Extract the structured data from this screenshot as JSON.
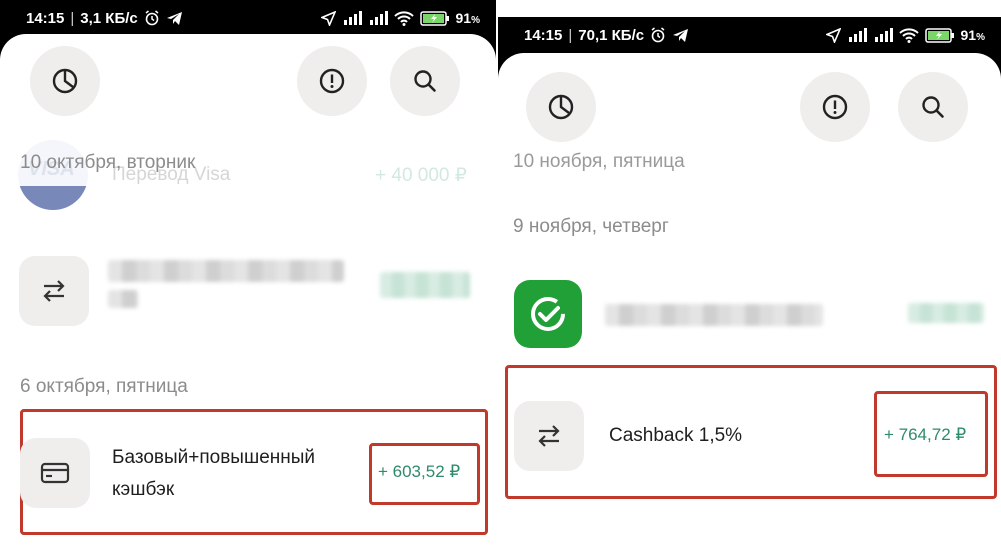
{
  "left": {
    "status": {
      "time": "14:15",
      "speed": "3,1 КБ/с",
      "battery": "91",
      "battery_unit": "%"
    },
    "dates": {
      "top": "10 октября, вторник",
      "second": "6 октября, пятница"
    },
    "faded_item": {
      "logo": "VISA",
      "name": "Перевод Visa",
      "amount": "+ 40 000 ₽"
    },
    "highlighted": {
      "title_line1": "Базовый+повышенный",
      "title_line2": "кэшбэк",
      "amount": "+ 603,52 ₽"
    }
  },
  "right": {
    "status": {
      "time": "14:15",
      "speed": "70,1 КБ/с",
      "battery": "91",
      "battery_unit": "%"
    },
    "dates": {
      "top": "10 ноября, пятница",
      "second": "9 ноября, четверг"
    },
    "highlighted": {
      "title": "Cashback 1,5%",
      "amount": "+ 764,72 ₽"
    }
  },
  "colors": {
    "accent_green": "#2e8b68",
    "highlight_red": "#c0392b",
    "sber_green": "#21a038"
  },
  "icons": [
    "pie-chart-icon",
    "alert-icon",
    "search-icon",
    "transfer-icon",
    "card-icon",
    "sber-check-icon"
  ]
}
